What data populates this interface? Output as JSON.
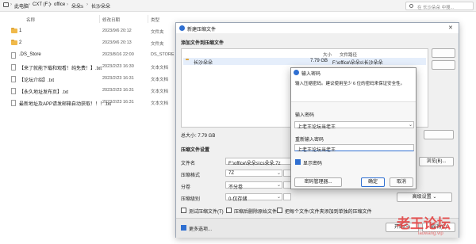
{
  "explorer": {
    "breadcrumb": [
      "此电脑",
      "CXT (F:)",
      "office",
      "朵朵s",
      "长沙朵朵"
    ],
    "search_placeholder": "在 长沙朵朵 中搜...",
    "columns": {
      "name": "名称",
      "date": "修改日期",
      "type": "类型"
    },
    "rows": [
      {
        "name": "1",
        "date": "2023/9/6 20:12",
        "type": "文件夹",
        "kind": "folder"
      },
      {
        "name": "2",
        "date": "2023/9/6 20:13",
        "type": "文件夹",
        "kind": "folder"
      },
      {
        "name": ".DS_Store",
        "date": "2023/8/16 22:00",
        "type": "DS_STORE",
        "kind": "file"
      },
      {
        "name": "【来了就能下载和观看！纯免费！】.txt",
        "date": "2023/2/23 16:30",
        "type": "文本文档",
        "kind": "file"
      },
      {
        "name": "【论坛介绍】.txt",
        "date": "2023/2/23 16:31",
        "type": "文本文档",
        "kind": "file"
      },
      {
        "name": "【永久地址发布页】.txt",
        "date": "2023/2/23 16:31",
        "type": "文本文档",
        "kind": "file"
      },
      {
        "name": "最新地址及APP请发邮箱自动获取！！！.txt",
        "date": "2023/2/23 16:31",
        "type": "文本文档",
        "kind": "file"
      }
    ]
  },
  "dialog": {
    "title": "新建压缩文件",
    "add_section": "添加文件到压缩文件",
    "list_headers": {
      "size": "大小",
      "path": "文件路径"
    },
    "list_item": {
      "name": "长沙朵朵",
      "size": "7.79 GB",
      "path": "F:\\office\\朵朵s\\长沙朵朵"
    },
    "total_size": "总大小: 7.79 GB",
    "settings_section": "压缩文件设置",
    "filename_label": "文件名",
    "filename_value": "F:\\office\\朵朵s\\cs朵朵.7z",
    "browse_button": "浏览(B)...",
    "format_label": "压缩格式",
    "format_value": "7Z",
    "split_label": "分卷",
    "split_value": "不分卷",
    "level_label": "压缩级别",
    "level_value": "0-仅存储",
    "advanced_button": "高级设置",
    "options": [
      {
        "label": "测试压缩文件(T)",
        "checked": false
      },
      {
        "label": "压缩后删除原始文件",
        "checked": false
      },
      {
        "label": "把每个文件/文件夹添加到单独的压缩文件",
        "checked": false
      }
    ],
    "more_options": "更多选项...",
    "more_checked": true,
    "start_button": "开始(S)",
    "cancel_button": "取消(C)"
  },
  "password": {
    "title": "输入密码",
    "hint": "输入压缩密码。建议使用至少 6 位的密码来保证安全性。",
    "enter_label": "输入密码",
    "enter_value": "上老王论坛当老王",
    "reenter_label": "重新输入密码",
    "reenter_value": "上老王论坛当老王",
    "show_password": "显示密码",
    "show_checked": true,
    "manager_button": "密码管理器...",
    "ok_button": "确定",
    "cancel_button": "取消"
  },
  "watermark": {
    "text": "老王论坛",
    "sub": "laowang.vip"
  },
  "colors": {
    "accent": "#2f6fd1",
    "folder": "#f0b94a",
    "watermark": "#e53b3b"
  }
}
